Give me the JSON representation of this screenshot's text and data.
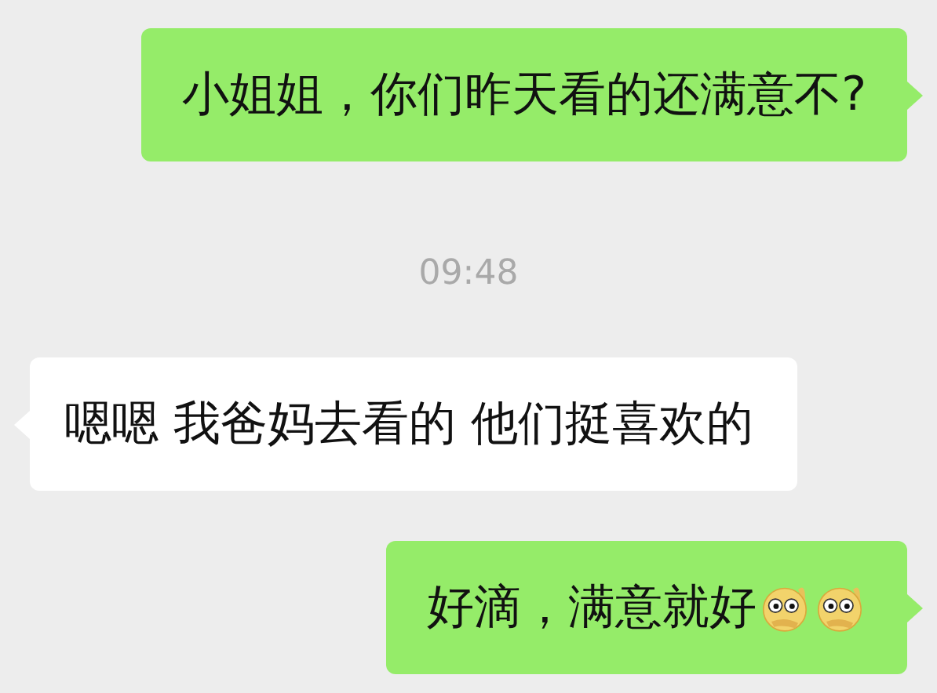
{
  "messages": [
    {
      "kind": "outgoing",
      "parts": [
        {
          "kind": "text",
          "text": "小姐姐，你们昨天看的还满意不?"
        }
      ]
    },
    {
      "kind": "time",
      "text": "09:48"
    },
    {
      "kind": "incoming",
      "parts": [
        {
          "kind": "text",
          "text": "嗯嗯 我爸妈去看的 他们挺喜欢的"
        }
      ]
    },
    {
      "kind": "outgoing",
      "parts": [
        {
          "kind": "text",
          "text": "好滴，满意就好"
        },
        {
          "kind": "emoji"
        },
        {
          "kind": "emoji"
        }
      ]
    }
  ]
}
